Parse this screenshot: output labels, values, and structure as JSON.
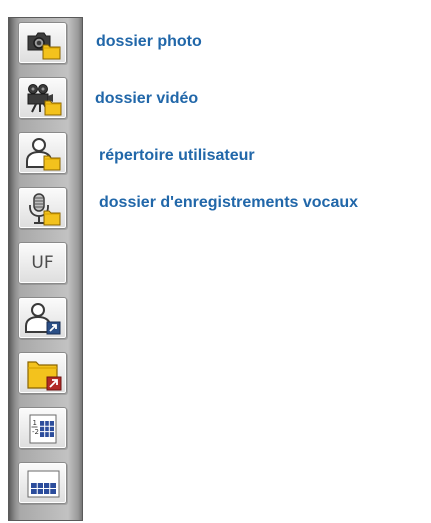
{
  "labels": {
    "photo": "dossier photo",
    "video": "dossier vidéo",
    "user": "répertoire utilisateur",
    "voice": "dossier d'enregistrements vocaux"
  },
  "buttons": {
    "uf_text": "UF"
  },
  "colors": {
    "label_text": "#2167a9",
    "folder_yellow": "#f3c21d",
    "folder_outline": "#8a6400",
    "link_arrow_blue": "#2b4f86",
    "link_arrow_red": "#b22a26",
    "grid_blue": "#2c4d9c"
  },
  "icons": [
    "photo-folder-icon",
    "video-folder-icon",
    "user-directory-icon",
    "voice-recordings-folder-icon",
    "uf-text-icon",
    "user-shortcut-icon",
    "folder-shortcut-icon",
    "fraction-table-icon",
    "table-grid-icon"
  ]
}
